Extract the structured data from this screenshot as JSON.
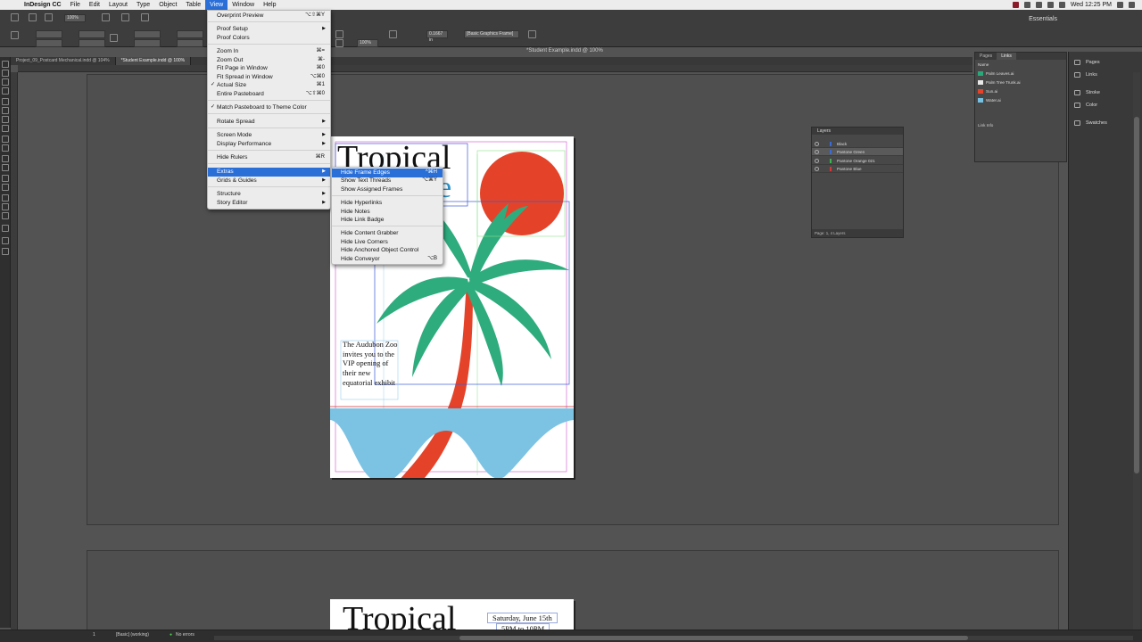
{
  "menubar": {
    "app": "InDesign CC",
    "items": [
      "File",
      "Edit",
      "Layout",
      "Type",
      "Object",
      "Table",
      "View",
      "Window",
      "Help"
    ],
    "active": "View",
    "clock": "Wed 12:25 PM"
  },
  "workspace": "Essentials",
  "document": {
    "title": "*Student Example.indd @ 100%",
    "tabs": [
      "Project_09_Postcard Mechanical.indd @ 104%",
      "*Student Example.indd @ 100%"
    ],
    "zoom": "100%"
  },
  "control_bar": {
    "fill_label": "[Basic Graphics Frame]",
    "stroke_value": "0.1667 in",
    "zoom_field": "100%",
    "percent_field": "100%"
  },
  "view_menu": {
    "items": [
      {
        "label": "Overprint Preview",
        "shortcut": "⌥⇧⌘Y"
      },
      {
        "label": "Proof Setup",
        "submenu": true
      },
      {
        "label": "Proof Colors"
      },
      {
        "label": "Zoom In",
        "shortcut": "⌘="
      },
      {
        "label": "Zoom Out",
        "shortcut": "⌘-"
      },
      {
        "label": "Fit Page in Window",
        "shortcut": "⌘0"
      },
      {
        "label": "Fit Spread in Window",
        "shortcut": "⌥⌘0"
      },
      {
        "label": "Actual Size",
        "shortcut": "⌘1",
        "checked": true
      },
      {
        "label": "Entire Pasteboard",
        "shortcut": "⌥⇧⌘0"
      },
      {
        "label": "Match Pasteboard to Theme Color",
        "checked": true
      },
      {
        "label": "Rotate Spread",
        "submenu": true
      },
      {
        "label": "Screen Mode",
        "submenu": true
      },
      {
        "label": "Display Performance",
        "submenu": true
      },
      {
        "label": "Hide Rulers",
        "shortcut": "⌘R"
      },
      {
        "label": "Extras",
        "submenu": true,
        "highlighted": true
      },
      {
        "label": "Grids & Guides",
        "submenu": true
      },
      {
        "label": "Structure",
        "submenu": true
      },
      {
        "label": "Story Editor",
        "submenu": true
      }
    ]
  },
  "extras_menu": {
    "items": [
      {
        "label": "Hide Frame Edges",
        "shortcut": "^⌘H",
        "highlighted": true
      },
      {
        "label": "Show Text Threads",
        "shortcut": "⌥⌘Y"
      },
      {
        "label": "Show Assigned Frames"
      },
      {
        "label": "Hide Hyperlinks"
      },
      {
        "label": "Hide Notes"
      },
      {
        "label": "Hide Link Badge"
      },
      {
        "label": "Hide Content Grabber"
      },
      {
        "label": "Hide Live Corners"
      },
      {
        "label": "Hide Anchored Object Control"
      },
      {
        "label": "Hide Conveyor",
        "shortcut": "⌥B"
      }
    ]
  },
  "layers_panel": {
    "title": "Layers",
    "layers": [
      {
        "name": "Black",
        "color": "#3a6bd8"
      },
      {
        "name": "Pantone Green",
        "color": "#3a6bd8",
        "selected": true
      },
      {
        "name": "Pantone Orange 021",
        "color": "#3fb34f"
      },
      {
        "name": "Pantone Blue",
        "color": "#d43a3a"
      }
    ],
    "footer": "Page: 1, 4 Layers"
  },
  "links_panel": {
    "tabs": [
      "Pages",
      "Links"
    ],
    "active_tab": "Links",
    "header": "Name",
    "links": [
      {
        "name": "Palm Leaves.ai",
        "thumb": "#2aa87a"
      },
      {
        "name": "Palm Tree Trunk.ai",
        "thumb": "#e8e8e8"
      },
      {
        "name": "Sun.ai",
        "thumb": "#e4432a"
      },
      {
        "name": "Water.ai",
        "thumb": "#76c1e2"
      }
    ],
    "info_label": "Link Info"
  },
  "dock": {
    "items": [
      "Pages",
      "Links",
      "Stroke",
      "Color",
      "Swatches"
    ]
  },
  "page1": {
    "title_line1": "Tropical",
    "title_line2": "pe",
    "body": "The Audubon Zoo invites you to the VIP opening of their new equatorial exhibit"
  },
  "page2": {
    "title": "Tropical",
    "date": "Saturday, June 15th",
    "time": "5PM to 10PM"
  },
  "statusbar": {
    "page": "1",
    "mode": "[Basic] (working)",
    "errors": "No errors"
  },
  "colors": {
    "sun": "#e4432a",
    "leaves": "#2eac7e",
    "trunk": "#e4432a",
    "water": "#7cc3e3",
    "accent": "#2a6fd8"
  }
}
